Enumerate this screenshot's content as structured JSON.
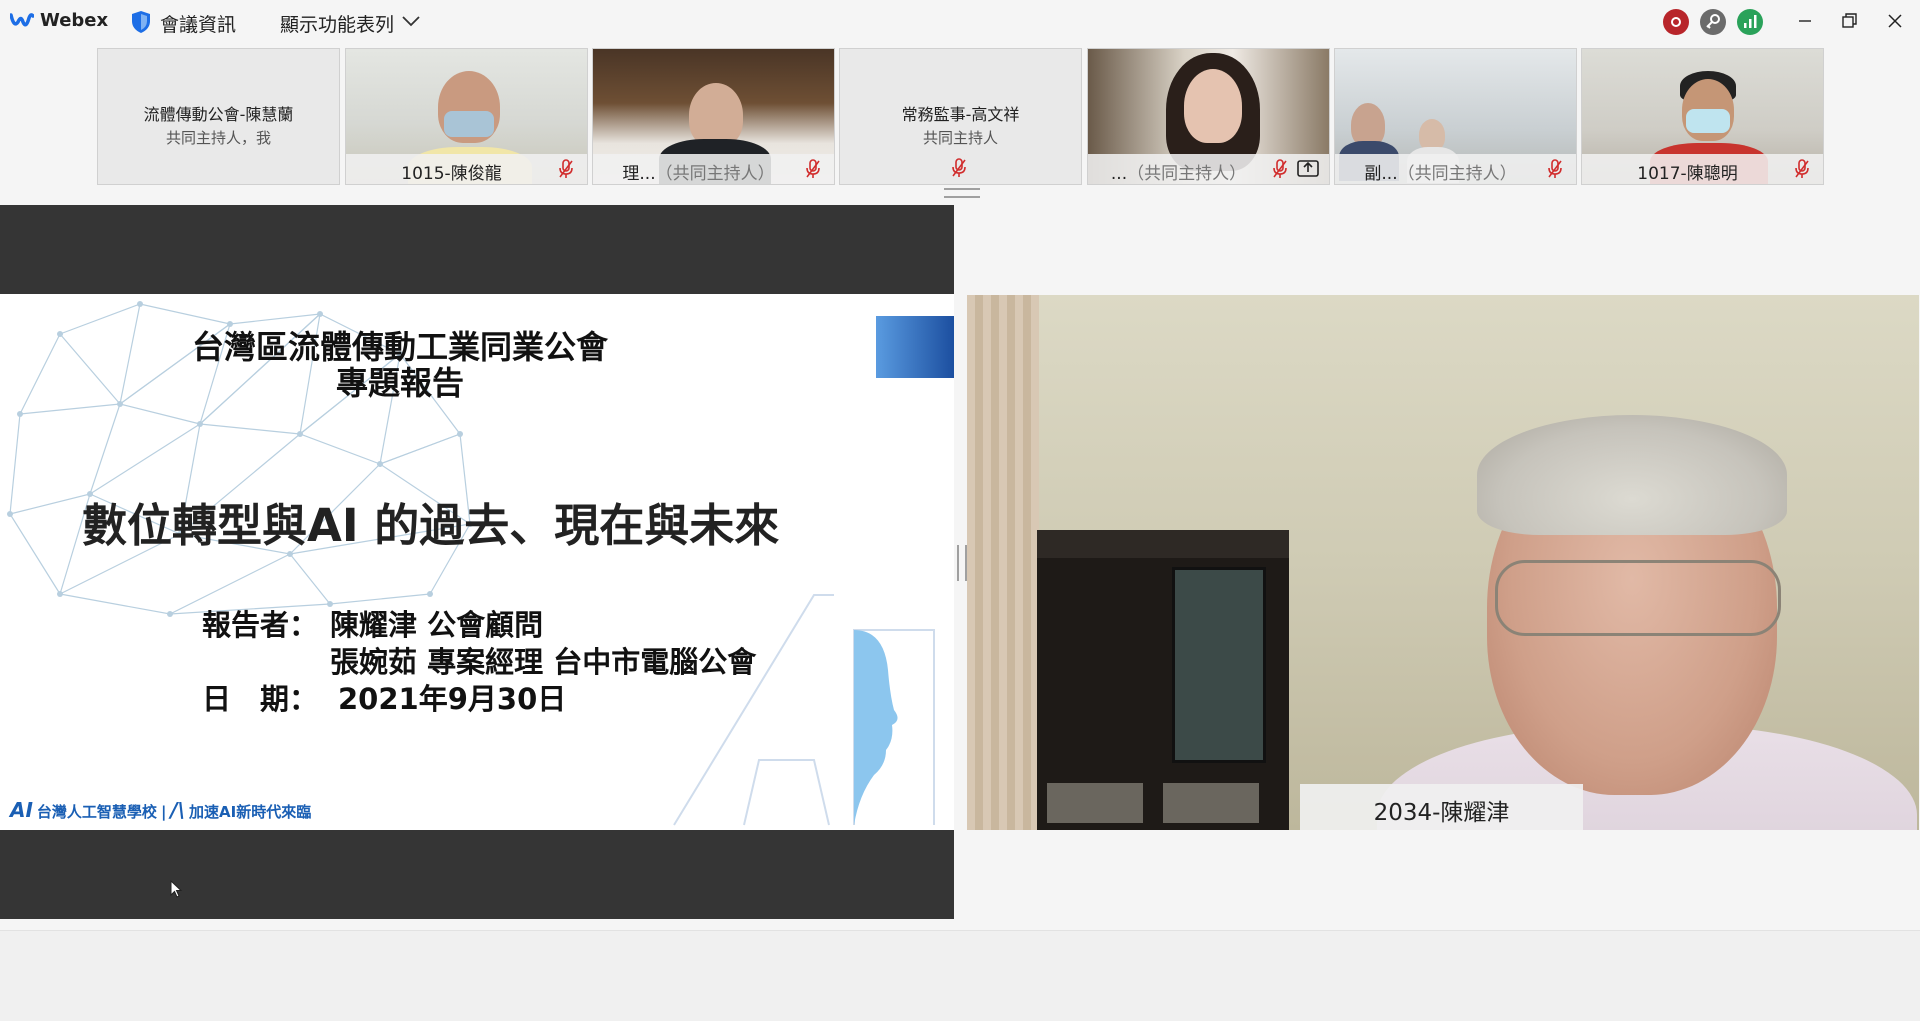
{
  "titlebar": {
    "app_name": "Webex",
    "meeting_info": "會議資訊",
    "show_menu": "顯示功能表列"
  },
  "participants": [
    {
      "name": "流體傳動公會-陳慧蘭",
      "role": "共同主持人，我",
      "video": false
    },
    {
      "label": "1015-陳俊龍",
      "video": true
    },
    {
      "label_name": "理...",
      "label_role": "（共同主持人）",
      "video": true
    },
    {
      "name": "常務監事-高文祥",
      "role": "共同主持人",
      "video": false
    },
    {
      "label_name": "...",
      "label_role": "（共同主持人）",
      "video": true,
      "sharing": true
    },
    {
      "label_name": "副...",
      "label_role": "（共同主持人）",
      "video": true
    },
    {
      "label": "1017-陳聰明",
      "video": true
    }
  ],
  "slide": {
    "title_line1": "台灣區流體傳動工業同業公會",
    "title_line2": "專題報告",
    "main_title": "數位轉型與AI 的過去、現在與未來",
    "reporter_label": "報告者：",
    "reporter_line1": "陳耀津 公會顧問",
    "reporter_line2": "張婉茹 專案經理 台中市電腦公會",
    "date_label": "日　期：",
    "date_value": "2021年9月30日",
    "footer_left": "台灣人工智慧學校",
    "footer_right": "加速AI新時代來臨"
  },
  "speaker": {
    "name": "2034-陳耀津"
  },
  "colors": {
    "record": "#b8252a",
    "signal": "#2aa25a",
    "webex_blue": "#1a5fb4"
  }
}
